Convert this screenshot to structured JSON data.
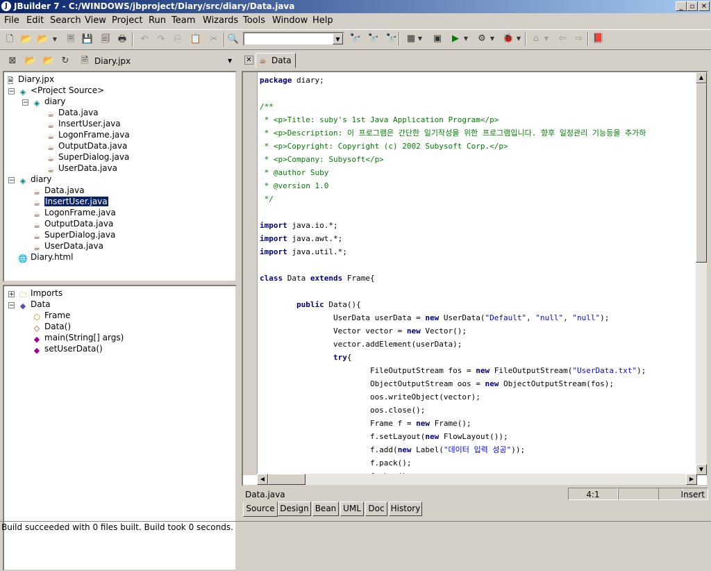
{
  "titlebar": {
    "title": "JBuilder 7 - C:/WINDOWS/jbproject/Diary/src/diary/Data.java",
    "minimize": "_",
    "maximize": "▫",
    "close": "✕"
  },
  "menu": [
    "File",
    "Edit",
    "Search",
    "View",
    "Project",
    "Run",
    "Team",
    "Wizards",
    "Tools",
    "Window",
    "Help"
  ],
  "toolbar": {
    "search_combo_value": ""
  },
  "project_toolbar": {
    "project_name": "Diary.jpx"
  },
  "project_tree": {
    "root": "Diary.jpx",
    "project_source": "<Project Source>",
    "pkg1": "diary",
    "pkg1_files": [
      "Data.java",
      "InsertUser.java",
      "LogonFrame.java",
      "OutputData.java",
      "SuperDialog.java",
      "UserData.java"
    ],
    "pkg2": "diary",
    "pkg2_files": [
      "Data.java",
      "InsertUser.java",
      "LogonFrame.java",
      "OutputData.java",
      "SuperDialog.java",
      "UserData.java"
    ],
    "html": "Diary.html"
  },
  "structure_tree": {
    "imports": "Imports",
    "class": "Data",
    "members": [
      "Frame",
      "Data()",
      "main(String[] args)",
      "setUserData()"
    ]
  },
  "editor": {
    "tab_label": "Data",
    "lines": [
      {
        "t": "kw",
        "s": "package",
        "r": " diary;"
      },
      {
        "t": "blank"
      },
      {
        "t": "cm",
        "s": "/**"
      },
      {
        "t": "cm",
        "s": " * <p>Title: suby's 1st Java Application Program</p>"
      },
      {
        "t": "cm",
        "s": " * <p>Description: 이 프로그램은 간단한 일기작성을 위한 프로그램입니다. 향후 일정관리 기능등을 추가하"
      },
      {
        "t": "cm",
        "s": " * <p>Copyright: Copyright (c) 2002 Subysoft Corp.</p>"
      },
      {
        "t": "cm",
        "s": " * <p>Company: Subysoft</p>"
      },
      {
        "t": "cm",
        "s": " * @author Suby"
      },
      {
        "t": "cm",
        "s": " * @version 1.0"
      },
      {
        "t": "cm",
        "s": " */"
      },
      {
        "t": "blank"
      },
      {
        "t": "kw",
        "s": "import",
        "r": " java.io.*;"
      },
      {
        "t": "kw",
        "s": "import",
        "r": " java.awt.*;"
      },
      {
        "t": "kw",
        "s": "import",
        "r": " java.util.*;"
      },
      {
        "t": "blank"
      },
      {
        "t": "mix",
        "p": [
          [
            "kw",
            "class"
          ],
          [
            "",
            " Data "
          ],
          [
            "kw",
            "extends"
          ],
          [
            "",
            " Frame{"
          ]
        ]
      },
      {
        "t": "blank"
      },
      {
        "t": "mix",
        "p": [
          [
            "",
            "        "
          ],
          [
            "kw",
            "public"
          ],
          [
            "",
            " Data(){"
          ]
        ]
      },
      {
        "t": "mix",
        "p": [
          [
            "",
            "                UserData userData = "
          ],
          [
            "kw",
            "new"
          ],
          [
            "",
            " UserData("
          ],
          [
            "st",
            "\"Default\""
          ],
          [
            "",
            ", "
          ],
          [
            "st",
            "\"null\""
          ],
          [
            "",
            ", "
          ],
          [
            "st",
            "\"null\""
          ],
          [
            "",
            ");"
          ]
        ]
      },
      {
        "t": "mix",
        "p": [
          [
            "",
            "                Vector vector = "
          ],
          [
            "kw",
            "new"
          ],
          [
            "",
            " Vector();"
          ]
        ]
      },
      {
        "t": "mix",
        "p": [
          [
            "",
            "                vector.addElement(userData);"
          ]
        ]
      },
      {
        "t": "mix",
        "p": [
          [
            "",
            "                "
          ],
          [
            "kw",
            "try"
          ],
          [
            "",
            "{"
          ]
        ]
      },
      {
        "t": "mix",
        "p": [
          [
            "",
            "                        FileOutputStream fos = "
          ],
          [
            "kw",
            "new"
          ],
          [
            "",
            " FileOutputStream("
          ],
          [
            "st",
            "\"UserData.txt\""
          ],
          [
            "",
            ");"
          ]
        ]
      },
      {
        "t": "mix",
        "p": [
          [
            "",
            "                        ObjectOutputStream oos = "
          ],
          [
            "kw",
            "new"
          ],
          [
            "",
            " ObjectOutputStream(fos);"
          ]
        ]
      },
      {
        "t": "mix",
        "p": [
          [
            "",
            "                        oos.writeObject(vector);"
          ]
        ]
      },
      {
        "t": "mix",
        "p": [
          [
            "",
            "                        oos.close();"
          ]
        ]
      },
      {
        "t": "mix",
        "p": [
          [
            "",
            "                        Frame f = "
          ],
          [
            "kw",
            "new"
          ],
          [
            "",
            " Frame();"
          ]
        ]
      },
      {
        "t": "mix",
        "p": [
          [
            "",
            "                        f.setLayout("
          ],
          [
            "kw",
            "new"
          ],
          [
            "",
            " FlowLayout());"
          ]
        ]
      },
      {
        "t": "mix",
        "p": [
          [
            "",
            "                        f.add("
          ],
          [
            "kw",
            "new"
          ],
          [
            "",
            " Label("
          ],
          [
            "st",
            "\"데이터 입력 성공\""
          ],
          [
            "",
            "));"
          ]
        ]
      },
      {
        "t": "mix",
        "p": [
          [
            "",
            "                        f.pack();"
          ]
        ]
      },
      {
        "t": "mix",
        "p": [
          [
            "",
            "                        f.show();"
          ]
        ]
      }
    ]
  },
  "editor_status": {
    "file": "Data.java",
    "position": "4:1",
    "mode": "Insert"
  },
  "editor_tabs": [
    "Source",
    "Design",
    "Bean",
    "UML",
    "Doc",
    "History"
  ],
  "statusbar": {
    "message": "Build succeeded with 0 files built.  Build took 0 seconds."
  }
}
